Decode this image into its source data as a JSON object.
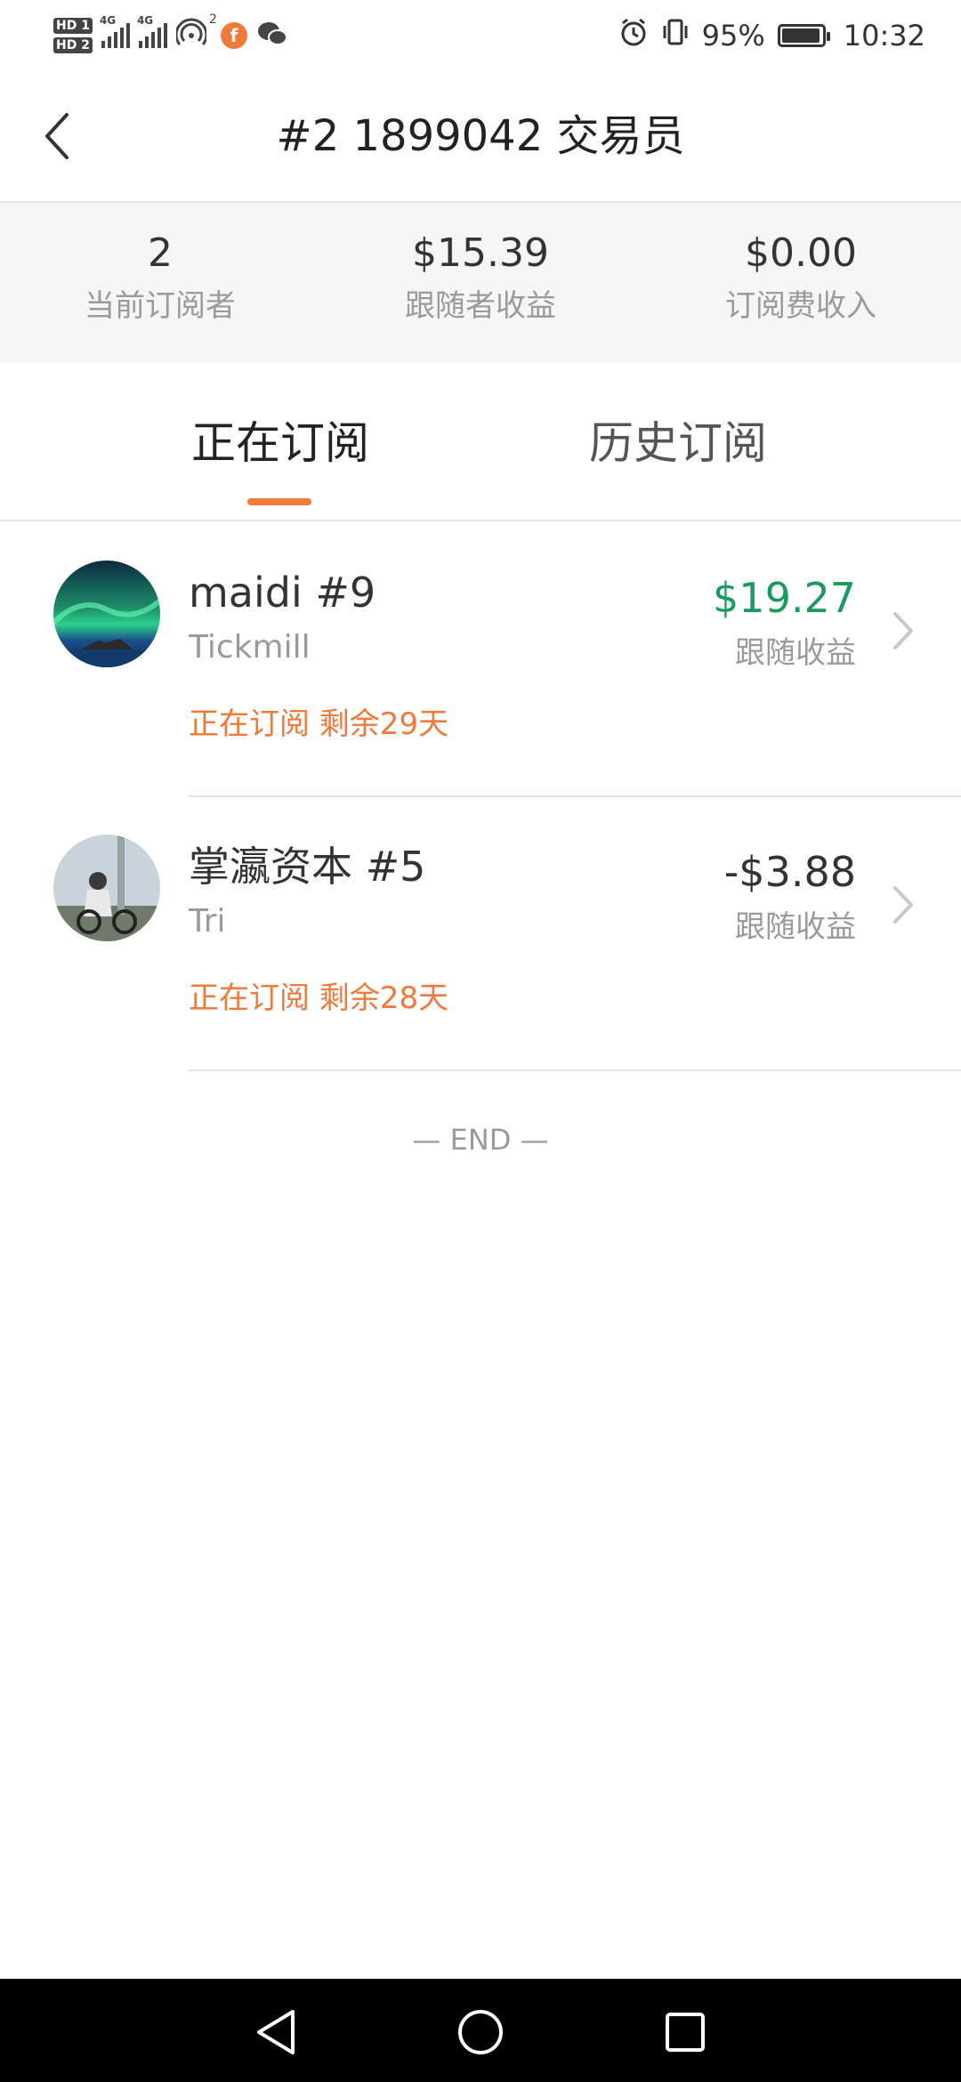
{
  "status_bar": {
    "hd1": "HD 1",
    "hd2": "HD 2",
    "net1": "4G",
    "net2": "4G",
    "hotspot_count": "2",
    "battery_percent": "95%",
    "battery_level": 0.95,
    "time": "10:32",
    "icons": [
      "signal-icon",
      "hotspot-icon",
      "app-notification-icon",
      "wechat-icon",
      "alarm-icon",
      "vibrate-icon",
      "battery-icon"
    ]
  },
  "header": {
    "title": "#2 1899042 交易员"
  },
  "stats": [
    {
      "value": "2",
      "label": "当前订阅者"
    },
    {
      "value": "$15.39",
      "label": "跟随者收益"
    },
    {
      "value": "$0.00",
      "label": "订阅费收入"
    }
  ],
  "tabs": [
    {
      "label": "正在订阅",
      "active": true
    },
    {
      "label": "历史订阅",
      "active": false
    }
  ],
  "subscriptions": [
    {
      "name": "maidi  #9",
      "broker": "Tickmill",
      "status": "正在订阅 剩余29天",
      "amount": "$19.27",
      "amount_label": "跟随收益",
      "amount_color": "#1a9a5c"
    },
    {
      "name": "掌瀛资本 #5",
      "broker": "Tri",
      "status": "正在订阅 剩余28天",
      "amount": "-$3.88",
      "amount_label": "跟随收益",
      "amount_color": "#333333"
    }
  ],
  "end_text": "— END —",
  "colors": {
    "accent": "#f07a3c",
    "positive": "#1a9a5c"
  }
}
